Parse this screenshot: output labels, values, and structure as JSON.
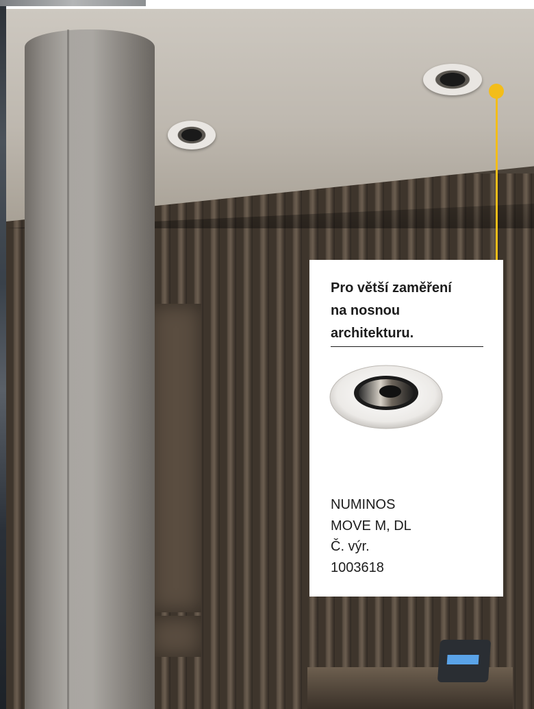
{
  "callout": {
    "title": "Pro větší zaměření\nna nosnou\narchitekturu.",
    "product_name_line1": "NUMINOS",
    "product_name_line2": "MOVE M, DL",
    "article_label": "Č. výr.",
    "article_number": "1003618",
    "accent_color": "#f3bd19",
    "product_icon": "recessed-downlight-product-image"
  },
  "scene": {
    "icons": [
      "concrete-pillar",
      "ceiling-downlight",
      "wood-slat-wall",
      "payment-terminal"
    ]
  }
}
